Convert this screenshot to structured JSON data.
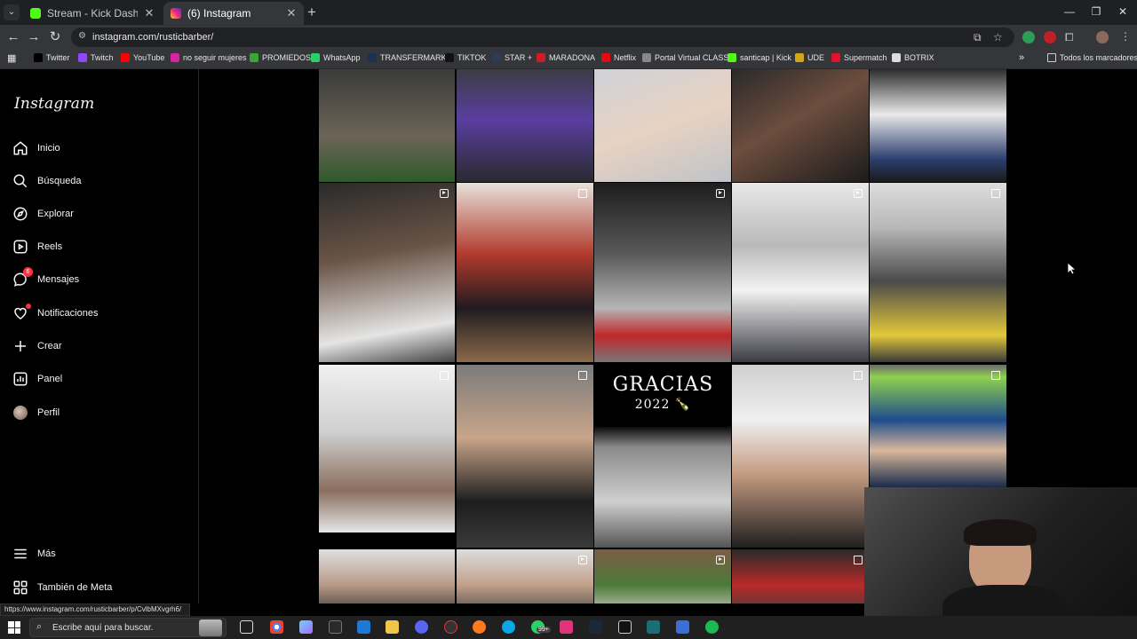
{
  "browser": {
    "tabs": [
      {
        "title": "Stream - Kick Dashboard",
        "favicon_color": "#53fc18",
        "active": false
      },
      {
        "title": "(6) Instagram",
        "favicon_color": "#d6249f",
        "active": true
      }
    ],
    "url": "instagram.com/rusticbarber/",
    "bookmarks": [
      {
        "label": "Twitter",
        "color": "#000000"
      },
      {
        "label": "Twitch",
        "color": "#9146ff"
      },
      {
        "label": "YouTube",
        "color": "#ff0000"
      },
      {
        "label": "no seguir mujeres",
        "color": "#d6249f"
      },
      {
        "label": "PROMIEDOS",
        "color": "#3aa635"
      },
      {
        "label": "WhatsApp",
        "color": "#25d366"
      },
      {
        "label": "TRANSFERMARKT",
        "color": "#1a3151"
      },
      {
        "label": "TIKTOK",
        "color": "#111111"
      },
      {
        "label": "STAR +",
        "color": "#2d3b55"
      },
      {
        "label": "MARADONA",
        "color": "#d11a2a"
      },
      {
        "label": "Netflix",
        "color": "#e50914"
      },
      {
        "label": "Portal Virtual CLASS",
        "color": "#888888"
      },
      {
        "label": "santicap | Kick",
        "color": "#53fc18"
      },
      {
        "label": "UDE",
        "color": "#d4a514"
      },
      {
        "label": "Supermatch",
        "color": "#e2132b"
      },
      {
        "label": "BOTRIX",
        "color": "#dddddd"
      }
    ],
    "bookmarks_overflow": "»",
    "bookmarks_folder": "Todos los marcadores"
  },
  "sidebar": {
    "logo": "Instagram",
    "items": [
      {
        "label": "Inicio",
        "icon": "home-icon"
      },
      {
        "label": "Búsqueda",
        "icon": "search-icon"
      },
      {
        "label": "Explorar",
        "icon": "compass-icon"
      },
      {
        "label": "Reels",
        "icon": "reels-icon"
      },
      {
        "label": "Mensajes",
        "icon": "messenger-icon",
        "badge": "6"
      },
      {
        "label": "Notificaciones",
        "icon": "heart-icon",
        "dot": true
      },
      {
        "label": "Crear",
        "icon": "plus-icon"
      },
      {
        "label": "Panel",
        "icon": "panel-icon"
      },
      {
        "label": "Perfil",
        "icon": "avatar"
      }
    ],
    "more": "Más",
    "meta": "También de Meta"
  },
  "feed": {
    "gracias_line1": "GRACIAS",
    "gracias_line2": "2022 🍾"
  },
  "status_url": "https://www.instagram.com/rusticbarber/p/CvlbMXvgrh6/",
  "taskbar": {
    "search_placeholder": "Escribe aquí para buscar.",
    "whatsapp_badge": "99+"
  }
}
